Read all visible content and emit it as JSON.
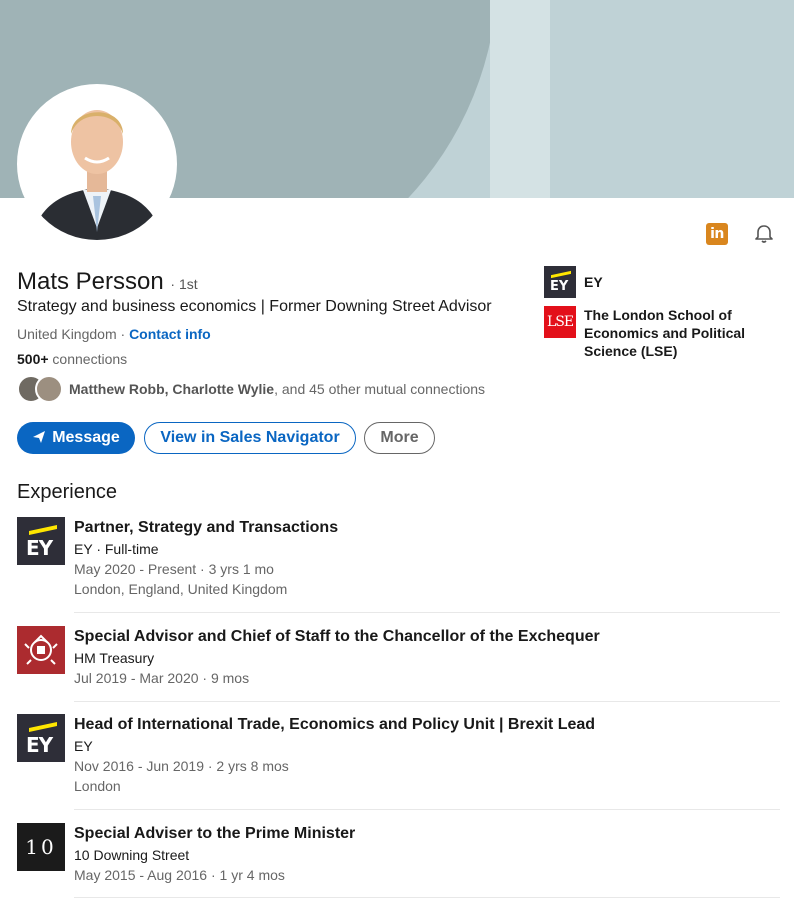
{
  "profile": {
    "name": "Mats Persson",
    "degree": "· 1st",
    "headline": "Strategy and business economics | Former Downing Street Advisor",
    "location": "United Kingdom · ",
    "contact_info": "Contact info",
    "connections_count": "500+",
    "connections_label": " connections",
    "mutual_names": "Matthew Robb, Charlotte Wylie",
    "mutual_rest": ", and 45 other mutual connections"
  },
  "actions": {
    "message": "Message",
    "sales_navigator": "View in Sales Navigator",
    "more": "More"
  },
  "icons": {
    "linkedin": "linkedin-icon",
    "linkedin_glyph": "in",
    "bell": "bell-icon"
  },
  "orgs": [
    {
      "name": "EY",
      "logo_text": "EY"
    },
    {
      "name": "The London School of Economics and Political Science (LSE)",
      "logo_text": "LSE"
    }
  ],
  "experience": {
    "title": "Experience",
    "items": [
      {
        "role": "Partner, Strategy and Transactions",
        "org": "EY · Full-time",
        "dates": "May 2020 - Present · 3 yrs 1 mo",
        "location": "London, England, United Kingdom",
        "logo_text": "EY"
      },
      {
        "role": "Special Advisor and Chief of Staff to the Chancellor of the Exchequer",
        "org": "HM Treasury",
        "dates": "Jul 2019 - Mar 2020 · 9 mos"
      },
      {
        "role": "Head of International Trade, Economics and Policy Unit | Brexit Lead",
        "org": "EY",
        "dates": "Nov 2016 - Jun 2019 · 2 yrs 8 mos",
        "location": "London",
        "logo_text": "EY"
      },
      {
        "role": "Special Adviser to the Prime Minister",
        "org": "10 Downing Street",
        "dates": "May 2015 - Aug 2016 · 1 yr 4 mos",
        "logo_text": "10"
      }
    ]
  },
  "colors": {
    "brand_blue": "#0a66c2",
    "ey_yellow": "#ffe600",
    "lse_red": "#e3101a"
  }
}
